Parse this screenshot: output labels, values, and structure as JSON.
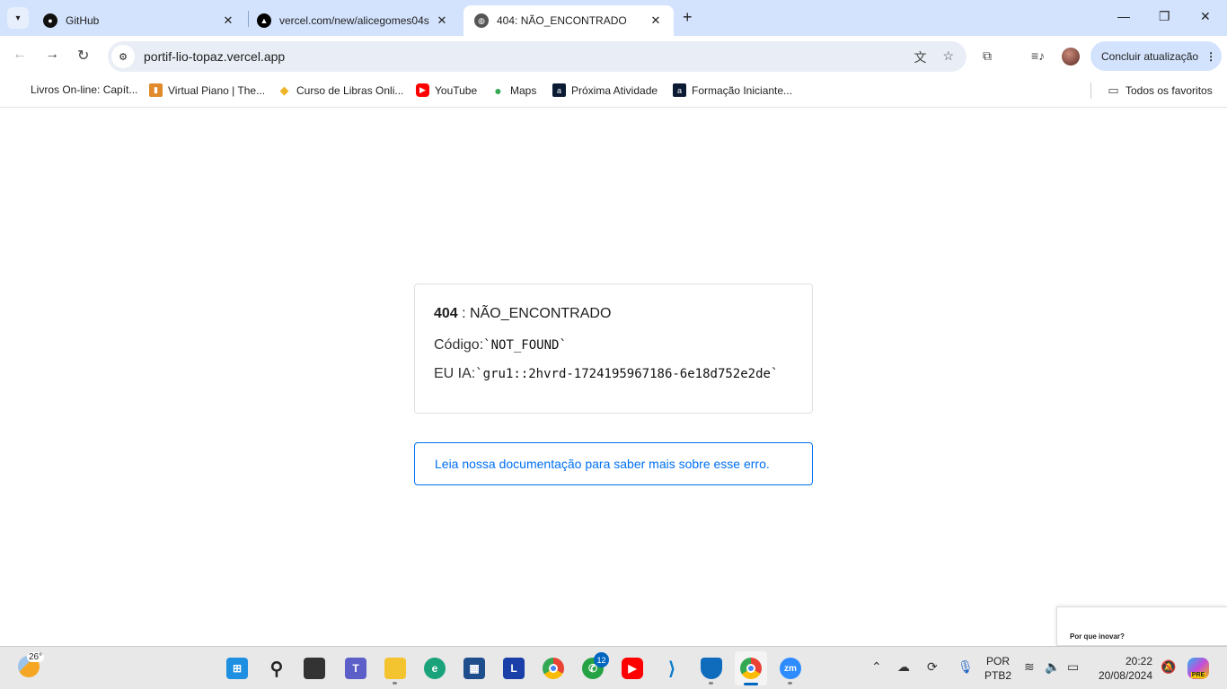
{
  "browser": {
    "tabs": [
      {
        "title": "GitHub",
        "icon": "github-icon"
      },
      {
        "title": "vercel.com/new/alicegomes04s",
        "icon": "vercel-icon"
      },
      {
        "title": "404: NÃO_ENCONTRADO",
        "icon": "globe-icon",
        "active": true
      }
    ],
    "address": "portif-lio-topaz.vercel.app",
    "update_label": "Concluir atualização",
    "bookmarks": [
      {
        "label": "Livros On-line: Capít..."
      },
      {
        "label": "Virtual Piano | The..."
      },
      {
        "label": "Curso de Libras Onli..."
      },
      {
        "label": "YouTube"
      },
      {
        "label": "Maps"
      },
      {
        "label": "Próxima Atividade"
      },
      {
        "label": "Formação Iniciante..."
      }
    ],
    "all_bookmarks": "Todos os favoritos"
  },
  "page": {
    "code": "404",
    "separator": " : ",
    "title": "NÃO_ENCONTRADO",
    "code_label": "Código:",
    "code_value": "`NOT_FOUND`",
    "id_label": "EU IA:",
    "id_value": "`gru1::2hvrd-1724195967186-6e18d752e2de`",
    "doc_link": "Leia nossa documentação para saber mais sobre esse erro.",
    "accent": "#0070f3"
  },
  "popup": {
    "text": "Por que inovar?"
  },
  "taskbar": {
    "weather": "26°",
    "apps": [
      "Start",
      "Search",
      "Task View",
      "Teams",
      "File Explorer",
      "Edge",
      "Microsoft Store",
      "L",
      "Chrome",
      "WhatsApp",
      "YouTube",
      "VS Code",
      "Defender",
      "Chrome",
      "Zoom"
    ],
    "whatsapp_badge": "12",
    "lang1": "POR",
    "lang2": "PTB2",
    "time": "20:22",
    "date": "20/08/2024",
    "copilot_badge": "PRE"
  }
}
